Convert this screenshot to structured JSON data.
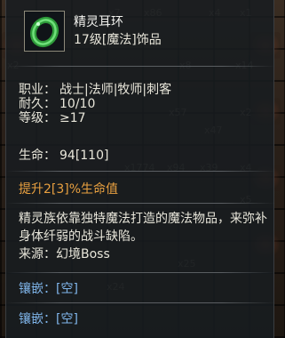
{
  "item": {
    "name": "精灵耳环",
    "type": "17级[魔法]饰品",
    "icon": "green-ring-icon",
    "icon_color": "#3cc24a"
  },
  "stats": {
    "class_label": "职业：",
    "class_value": "战士|法师|牧师|刺客",
    "durability_label": "耐久：",
    "durability_value": "10/10",
    "level_label": "等级：",
    "level_value": "≥17",
    "hp_label": "生命：",
    "hp_value": "94[110]"
  },
  "bonus": "提升2[3]%生命值",
  "description": "精灵族依靠独特魔法打造的魔法物品，来弥补身体纤弱的战斗缺陷。",
  "source": "来源：幻境Boss",
  "sockets": [
    "镶嵌：[空]",
    "镶嵌：[空]"
  ],
  "background_counts": [
    "x7",
    "x86",
    "x4",
    "x1",
    "x2",
    "x8",
    "x14",
    "x57",
    "x2",
    "x47",
    "x94",
    "x1774",
    "x39",
    "x4",
    "x5",
    "x25",
    "x24"
  ],
  "colors": {
    "bonus": "#e8a040",
    "socket": "#7fb5ea",
    "text": "#e8e6da"
  }
}
